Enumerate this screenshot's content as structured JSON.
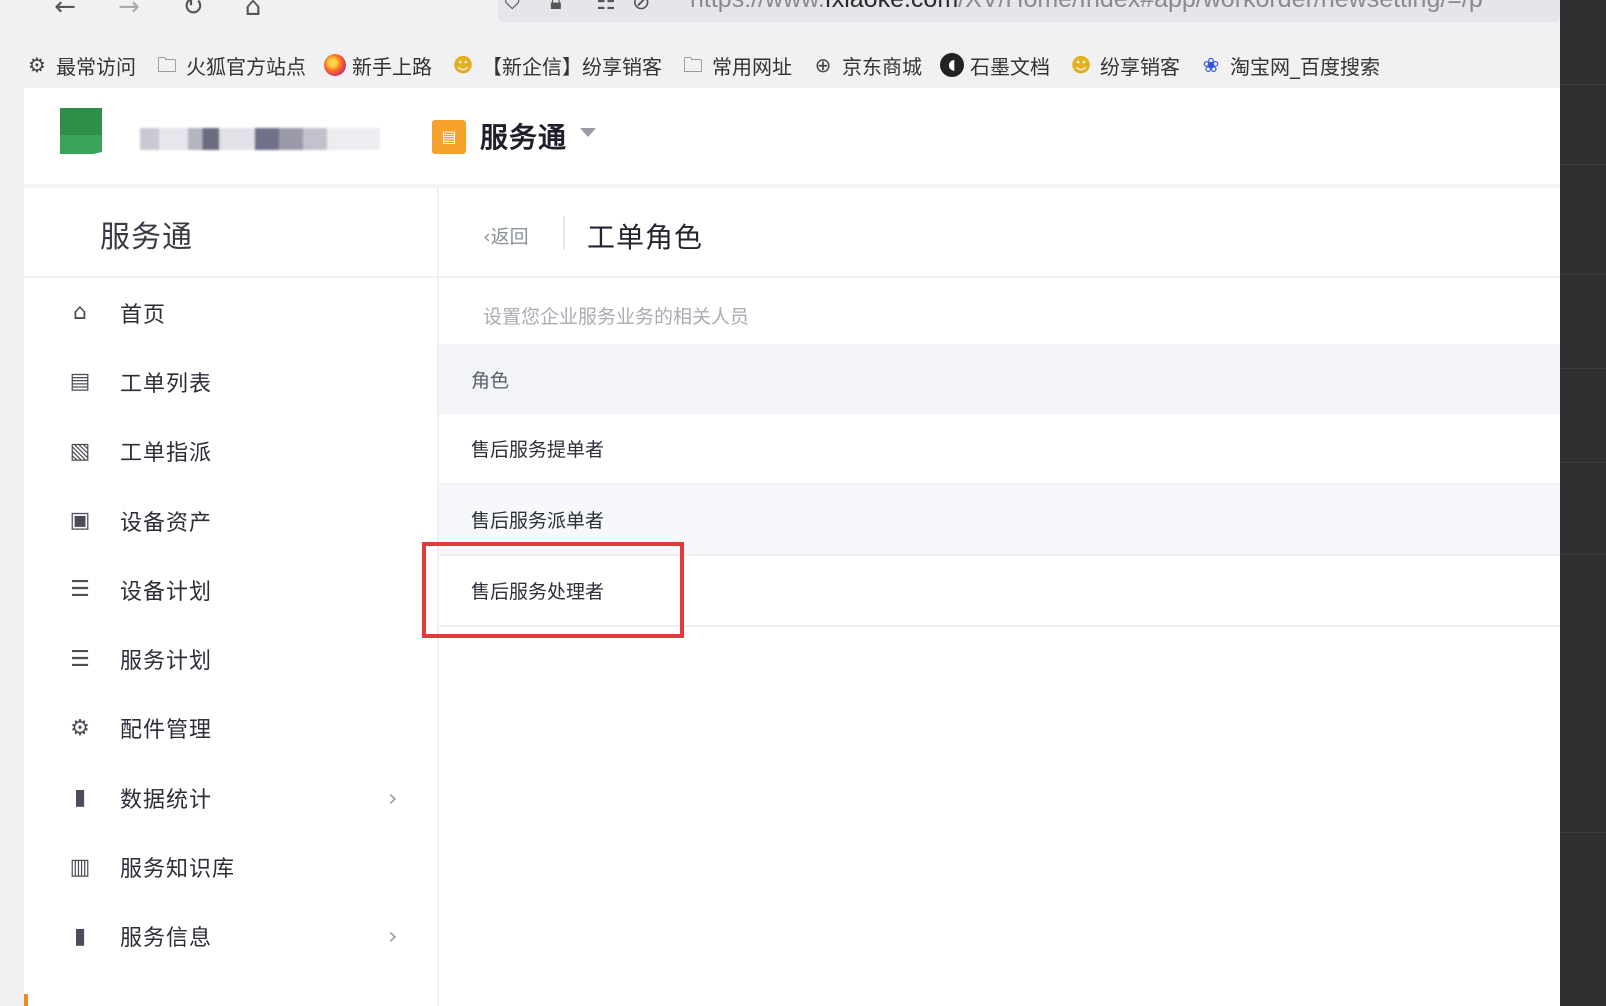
{
  "browser": {
    "nav": {
      "back": "←",
      "forward": "→",
      "reload": "↻",
      "home": "⌂"
    },
    "url_prefix": "https://www.",
    "url_domain": "fxiaoke.com",
    "url_path": "/XV/Home/Index#app/workorder/newsetting/=/p",
    "bookmarks": [
      {
        "label": "最常访问",
        "icon": "gear-icon"
      },
      {
        "label": "火狐官方站点",
        "icon": "folder-icon"
      },
      {
        "label": "新手上路",
        "icon": "firefox-icon"
      },
      {
        "label": "【新企信】纷享销客",
        "icon": "mascot-icon"
      },
      {
        "label": "常用网址",
        "icon": "folder-icon"
      },
      {
        "label": "京东商城",
        "icon": "globe-icon"
      },
      {
        "label": "石墨文档",
        "icon": "shimo-icon"
      },
      {
        "label": "纷享销客",
        "icon": "mascot-icon"
      },
      {
        "label": "淘宝网_百度搜索",
        "icon": "paw-icon"
      }
    ]
  },
  "app": {
    "product_name": "服务通",
    "sidebar": {
      "title": "服务通",
      "items": [
        {
          "label": "首页",
          "icon": "home-icon",
          "glyph": "⌂",
          "has_arrow": false
        },
        {
          "label": "工单列表",
          "icon": "clipboard-icon",
          "glyph": "▤",
          "has_arrow": false
        },
        {
          "label": "工单指派",
          "icon": "assign-icon",
          "glyph": "▧",
          "has_arrow": false
        },
        {
          "label": "设备资产",
          "icon": "device-card-icon",
          "glyph": "▣",
          "has_arrow": false
        },
        {
          "label": "设备计划",
          "icon": "plan-icon",
          "glyph": "☰",
          "has_arrow": false
        },
        {
          "label": "服务计划",
          "icon": "plan-icon",
          "glyph": "☰",
          "has_arrow": false
        },
        {
          "label": "配件管理",
          "icon": "parts-icon",
          "glyph": "⚙",
          "has_arrow": false
        },
        {
          "label": "数据统计",
          "icon": "bar-chart-icon",
          "glyph": "▮",
          "has_arrow": true
        },
        {
          "label": "服务知识库",
          "icon": "book-icon",
          "glyph": "▥",
          "has_arrow": true
        },
        {
          "label": "服务信息",
          "icon": "bar-chart-icon",
          "glyph": "▮",
          "has_arrow": true
        }
      ]
    },
    "content": {
      "back_label": "返回",
      "title": "工单角色",
      "hint": "设置您企业服务业务的相关人员",
      "table": {
        "header": "角色",
        "rows": [
          "售后服务提单者",
          "售后服务派单者",
          "售后服务处理者"
        ]
      }
    },
    "colors": {
      "accent": "#f5a12b",
      "highlight": "#e03a3a",
      "active_bar": "#f08a24"
    }
  }
}
